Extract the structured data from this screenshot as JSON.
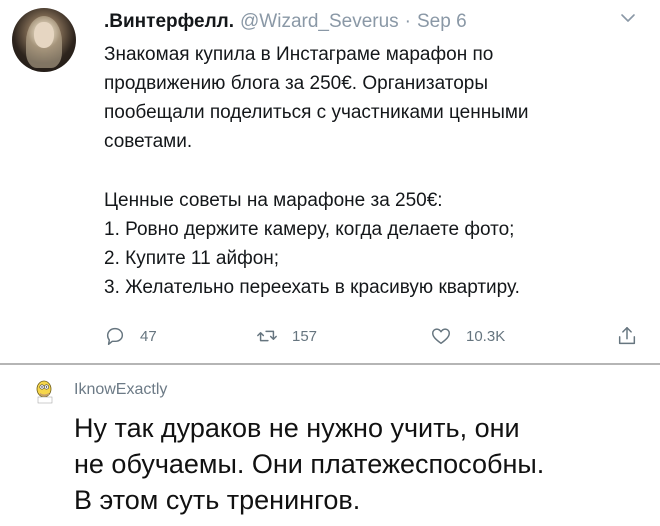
{
  "tweet": {
    "display_name": ".Винтерфелл.",
    "handle": "@Wizard_Severus",
    "separator": "·",
    "date": "Sep 6",
    "paragraph1": [
      "Знакомая купила в Инстаграме марафон по",
      "продвижению блога за 250€. Организаторы",
      "пообещали поделиться с участниками ценными",
      "советами."
    ],
    "paragraph2": [
      "Ценные советы на марафоне за 250€:",
      "1. Ровно держите камеру, когда делаете фото;",
      "2. Купите 11 айфон;",
      "3. Желательно переехать в красивую квартиру."
    ],
    "actions": {
      "replies": "47",
      "retweets": "157",
      "likes": "10.3K"
    },
    "icons": {
      "menu": "chevron-down-icon",
      "reply": "reply-icon",
      "retweet": "retweet-icon",
      "like": "heart-icon",
      "share": "share-icon"
    }
  },
  "comment": {
    "username": "IknowExactly",
    "lines": [
      "Ну так дураков не нужно учить, они",
      "не обучаемы. Они платежеспособны.",
      "В этом суть тренингов."
    ],
    "avatar_icon": "homer-avatar-icon"
  },
  "colors": {
    "secondary_text": "#8a98a6",
    "action_icon": "#66757f",
    "divider": "#b5b5b5"
  }
}
